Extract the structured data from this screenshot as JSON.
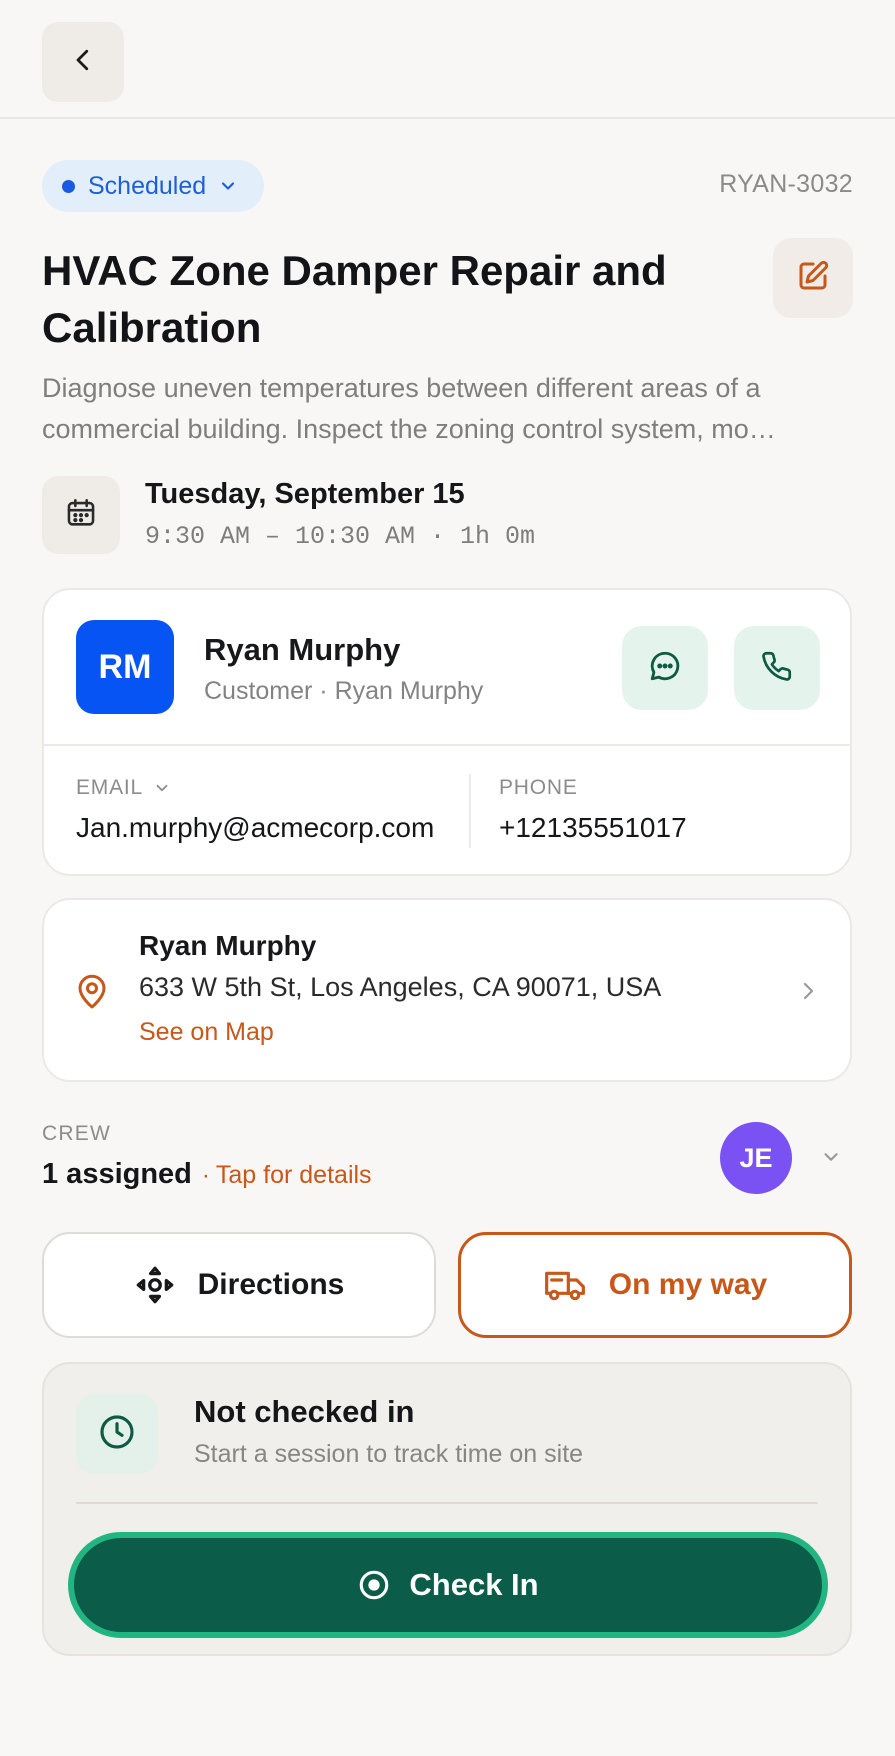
{
  "header": {
    "back_icon": "chevron-left-icon"
  },
  "job": {
    "status": "Scheduled",
    "id": "RYAN-3032",
    "title": "HVAC Zone Damper Repair and Calibration",
    "description": "Diagnose uneven temperatures between different areas of a commercial building. Inspect the zoning control system, mo…",
    "date": "Tuesday, September 15",
    "time": "9:30 AM – 10:30 AM · 1h 0m",
    "status_color": "#1d5fd6"
  },
  "contact": {
    "initials": "RM",
    "name": "Ryan Murphy",
    "subtitle": "Customer · Ryan Murphy",
    "email_label": "EMAIL",
    "email": "Jan.murphy@acmecorp.com",
    "phone_label": "PHONE",
    "phone": "+12135551017",
    "avatar_color": "#0754f5"
  },
  "address": {
    "name": "Ryan Murphy",
    "line": "633 W 5th St, Los Angeles, CA 90071, USA",
    "map_link": "See on Map"
  },
  "crew": {
    "label": "CREW",
    "count": "1 assigned",
    "separator": "·",
    "tap": "Tap for details",
    "avatar_initials": "JE",
    "avatar_color": "#7a52f4"
  },
  "actions": {
    "directions": "Directions",
    "on_my_way": "On my way",
    "accent": "#c8571a"
  },
  "checkin": {
    "title": "Not checked in",
    "subtitle": "Start a session to track time on site",
    "button": "Check In",
    "button_color": "#0b5c48"
  }
}
